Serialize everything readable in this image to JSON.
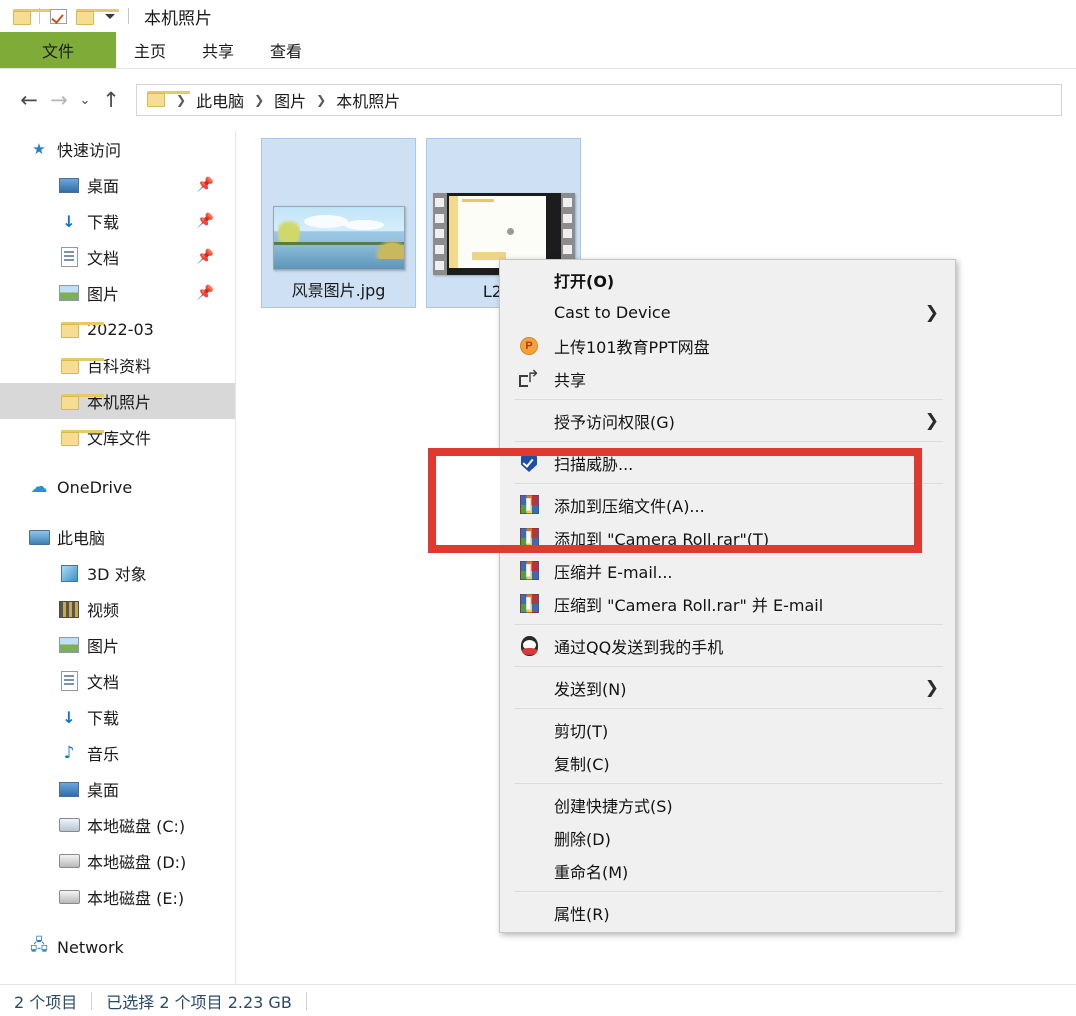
{
  "window": {
    "title": "本机照片",
    "quick_access_toolbar": [
      {
        "icon": "folder-icon"
      },
      {
        "icon": "checkbox-checked-icon"
      },
      {
        "icon": "folder-icon"
      },
      {
        "icon": "chevron-down-icon"
      }
    ]
  },
  "ribbon": {
    "tabs": [
      {
        "label": "文件",
        "active": true
      },
      {
        "label": "主页",
        "active": false
      },
      {
        "label": "共享",
        "active": false
      },
      {
        "label": "查看",
        "active": false
      }
    ]
  },
  "address_bar": {
    "back_icon": "arrow-left-icon",
    "forward_icon": "arrow-right-icon",
    "history_icon": "chevron-down-icon",
    "up_icon": "arrow-up-icon",
    "breadcrumbs": [
      "此电脑",
      "图片",
      "本机照片"
    ]
  },
  "sidebar": {
    "groups": [
      {
        "name": "快速访问",
        "icon": "star-pin-icon",
        "items": [
          {
            "label": "桌面",
            "icon": "desktop-icon",
            "pinned": true
          },
          {
            "label": "下载",
            "icon": "download-icon",
            "pinned": true
          },
          {
            "label": "文档",
            "icon": "documents-icon",
            "pinned": true
          },
          {
            "label": "图片",
            "icon": "pictures-icon",
            "pinned": true
          },
          {
            "label": "2022-03",
            "icon": "folder-icon",
            "pinned": false
          },
          {
            "label": "百科资料",
            "icon": "folder-icon",
            "pinned": false
          },
          {
            "label": "本机照片",
            "icon": "folder-icon",
            "pinned": false,
            "selected": true
          },
          {
            "label": "文库文件",
            "icon": "folder-icon",
            "pinned": false
          }
        ]
      },
      {
        "name": "OneDrive",
        "icon": "cloud-icon",
        "items": []
      },
      {
        "name": "此电脑",
        "icon": "this-pc-icon",
        "items": [
          {
            "label": "3D 对象",
            "icon": "3d-objects-icon"
          },
          {
            "label": "视频",
            "icon": "videos-icon"
          },
          {
            "label": "图片",
            "icon": "pictures-icon"
          },
          {
            "label": "文档",
            "icon": "documents-icon"
          },
          {
            "label": "下载",
            "icon": "download-icon"
          },
          {
            "label": "音乐",
            "icon": "music-icon"
          },
          {
            "label": "桌面",
            "icon": "desktop-icon"
          },
          {
            "label": "本地磁盘 (C:)",
            "icon": "system-drive-icon"
          },
          {
            "label": "本地磁盘 (D:)",
            "icon": "drive-icon"
          },
          {
            "label": "本地磁盘 (E:)",
            "icon": "drive-icon"
          }
        ]
      },
      {
        "name": "Network",
        "icon": "network-icon",
        "items": []
      }
    ]
  },
  "files": [
    {
      "name": "风景图片.jpg",
      "type": "photo",
      "selected": true
    },
    {
      "name": "L2-2(",
      "type": "video",
      "selected": true
    }
  ],
  "context_menu": {
    "sections": [
      {
        "items": [
          {
            "label": "打开(O)",
            "bold": true,
            "icon": null,
            "submenu": false
          },
          {
            "label": "Cast to Device",
            "bold": false,
            "icon": null,
            "submenu": true
          },
          {
            "label": "上传101教育PPT网盘",
            "bold": false,
            "icon": "ppt-upload-icon",
            "submenu": false
          },
          {
            "label": "共享",
            "bold": false,
            "icon": "share-icon",
            "submenu": false
          }
        ]
      },
      {
        "items": [
          {
            "label": "授予访问权限(G)",
            "bold": false,
            "icon": null,
            "submenu": true
          }
        ]
      },
      {
        "items": [
          {
            "label": "扫描威胁...",
            "bold": false,
            "icon": "shield-scan-icon",
            "submenu": false
          }
        ]
      },
      {
        "items": [
          {
            "label": "添加到压缩文件(A)...",
            "bold": false,
            "icon": "winrar-icon",
            "submenu": false
          },
          {
            "label": "添加到 \"Camera Roll.rar\"(T)",
            "bold": false,
            "icon": "winrar-icon",
            "submenu": false
          },
          {
            "label": "压缩并 E-mail...",
            "bold": false,
            "icon": "winrar-icon",
            "submenu": false
          },
          {
            "label": "压缩到 \"Camera Roll.rar\" 并 E-mail",
            "bold": false,
            "icon": "winrar-icon",
            "submenu": false
          }
        ]
      },
      {
        "items": [
          {
            "label": "通过QQ发送到我的手机",
            "bold": false,
            "icon": "qq-icon",
            "submenu": false
          }
        ]
      },
      {
        "items": [
          {
            "label": "发送到(N)",
            "bold": false,
            "icon": null,
            "submenu": true
          }
        ]
      },
      {
        "items": [
          {
            "label": "剪切(T)",
            "bold": false,
            "icon": null,
            "submenu": false
          },
          {
            "label": "复制(C)",
            "bold": false,
            "icon": null,
            "submenu": false
          }
        ]
      },
      {
        "items": [
          {
            "label": "创建快捷方式(S)",
            "bold": false,
            "icon": null,
            "submenu": false
          },
          {
            "label": "删除(D)",
            "bold": false,
            "icon": null,
            "submenu": false
          },
          {
            "label": "重命名(M)",
            "bold": false,
            "icon": null,
            "submenu": false
          }
        ]
      },
      {
        "items": [
          {
            "label": "属性(R)",
            "bold": false,
            "icon": null,
            "submenu": false
          }
        ]
      }
    ]
  },
  "annotation": {
    "color": "#e03a30",
    "shape": "rectangle-highlight"
  },
  "status_bar": {
    "item_count": "2 个项目",
    "selection": "已选择 2 个项目  2.23 GB"
  },
  "colors": {
    "file_tab_green": "#7FAB38",
    "selection_blue": "#cde0f4",
    "sidebar_selected": "#d8d8d8",
    "menu_background": "#f0f0f0",
    "annotation_red": "#e03a30"
  }
}
